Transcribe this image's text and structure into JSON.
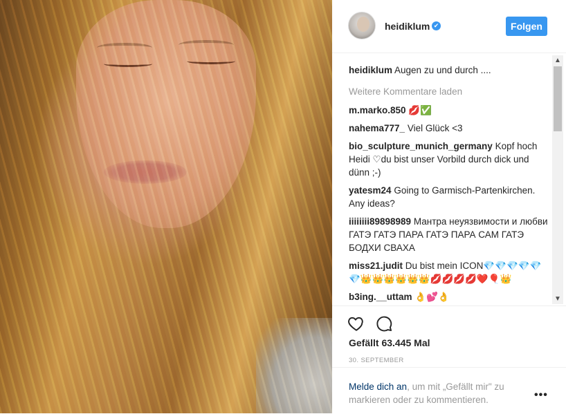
{
  "post": {
    "username": "heidiklum",
    "verified_badge": "✔",
    "follow_label": "Folgen",
    "caption_user": "heidiklum",
    "caption_text": "Augen zu und durch ....",
    "load_more": "Weitere Kommentare laden",
    "comments": [
      {
        "user": "m.marko.850",
        "text": "💋✅"
      },
      {
        "user": "nahema777_",
        "text": "Viel Glück <3"
      },
      {
        "user": "bio_sculpture_munich_germany",
        "text": "Kopf hoch Heidi ♡du bist unser Vorbild durch dick und dünn ;-)"
      },
      {
        "user": "yatesm24",
        "text": "Going to Garmisch-Partenkirchen. Any ideas?"
      },
      {
        "user": "iiiiiiii89898989",
        "text": "Мантра неуязвимости и любви ГАТЭ ГАТЭ ПАРА ГАТЭ ПАРА САМ ГАТЭ БОДХИ СВАХА"
      },
      {
        "user": "miss21.judit",
        "text": "Du bist mein ICON💎💎💎💎💎💎👑👑👑👑👑👑💋💋💋💋❤️🎈👑"
      },
      {
        "user": "b3ing.__uttam",
        "text": "👌💕👌"
      }
    ],
    "likes": "Gefällt 63.445 Mal",
    "date": "30. SEPTEMBER",
    "login_link": "Melde dich an",
    "login_rest": ", um mit „Gefällt mir\" zu markieren oder zu kommentieren.",
    "more_label": "•••"
  },
  "icons": {
    "like": "heart-icon",
    "comment": "comment-icon"
  },
  "colors": {
    "accent": "#3897f0",
    "link": "#003569",
    "muted": "#999999",
    "text": "#262626"
  }
}
